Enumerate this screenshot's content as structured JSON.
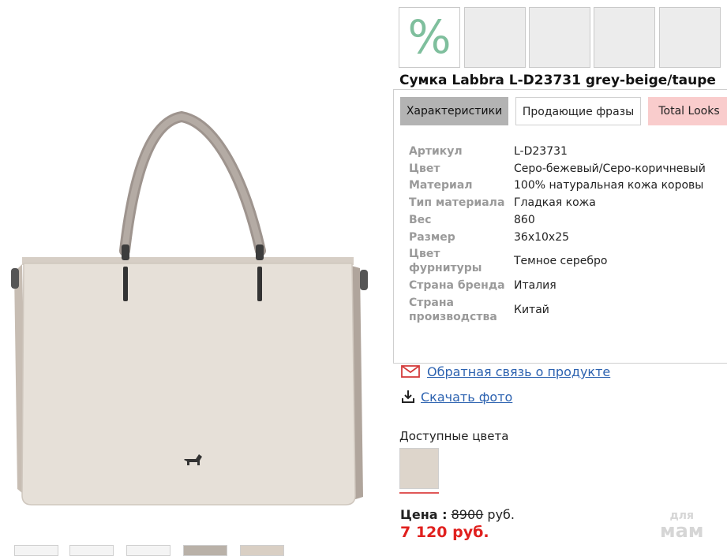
{
  "product": {
    "title": "Сумка Labbra L-D23731 grey-beige/taupe",
    "discount_symbol": "%",
    "bag_color": "#e6e0d8"
  },
  "tabs": [
    {
      "label": "Характеристики",
      "active": true
    },
    {
      "label": "Продающие фразы",
      "active": false
    },
    {
      "label": "Total Looks",
      "active": false
    }
  ],
  "specs": [
    {
      "label": "Артикул",
      "value": "L-D23731"
    },
    {
      "label": "Цвет",
      "value": "Серо-бежевый/Серо-коричневый"
    },
    {
      "label": "Материал",
      "value": "100% натуральная кожа коровы"
    },
    {
      "label": "Тип материала",
      "value": "Гладкая кожа"
    },
    {
      "label": "Вес",
      "value": "860"
    },
    {
      "label": "Размер",
      "value": "36x10x25"
    },
    {
      "label": "Цвет фурнитуры",
      "value": "Темное серебро"
    },
    {
      "label": "Страна бренда",
      "value": "Италия"
    },
    {
      "label": "Страна производства",
      "value": "Китай"
    }
  ],
  "links": {
    "feedback": "Обратная связь о продукте",
    "download": "Скачать фото"
  },
  "colors": {
    "heading": "Доступные цвета",
    "swatch_color": "#ddd5cb"
  },
  "price": {
    "label": "Цена :",
    "old": "8900",
    "currency": "руб.",
    "new": "7 120 руб."
  },
  "watermark": {
    "line1": "для",
    "line2": "мам"
  }
}
